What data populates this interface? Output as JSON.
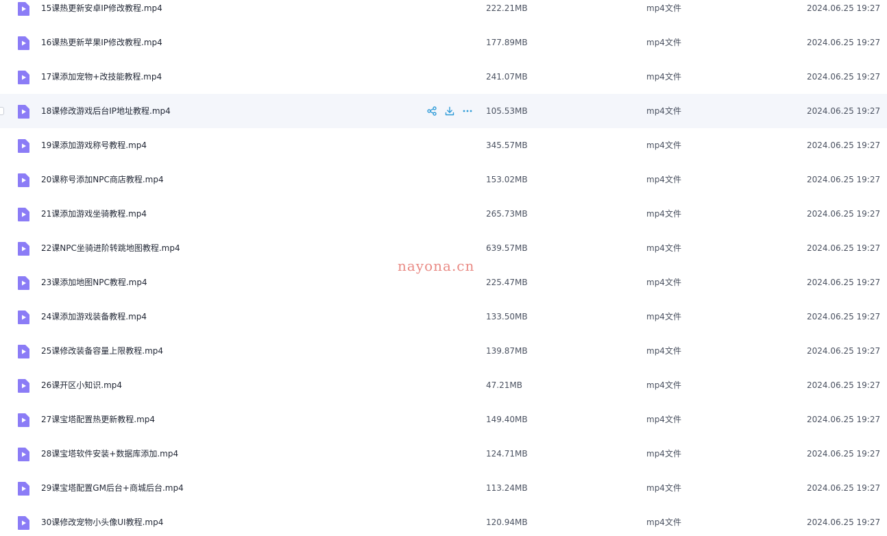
{
  "files": [
    {
      "name": "15课热更新安卓IP修改教程.mp4",
      "size": "222.21MB",
      "type": "mp4文件",
      "date": "2024.06.25 19:27"
    },
    {
      "name": "16课热更新苹果IP修改教程.mp4",
      "size": "177.89MB",
      "type": "mp4文件",
      "date": "2024.06.25 19:27"
    },
    {
      "name": "17课添加宠物+改技能教程.mp4",
      "size": "241.07MB",
      "type": "mp4文件",
      "date": "2024.06.25 19:27"
    },
    {
      "name": "18课修改游戏后台IP地址教程.mp4",
      "size": "105.53MB",
      "type": "mp4文件",
      "date": "2024.06.25 19:27"
    },
    {
      "name": "19课添加游戏称号教程.mp4",
      "size": "345.57MB",
      "type": "mp4文件",
      "date": "2024.06.25 19:27"
    },
    {
      "name": "20课称号添加NPC商店教程.mp4",
      "size": "153.02MB",
      "type": "mp4文件",
      "date": "2024.06.25 19:27"
    },
    {
      "name": "21课添加游戏坐骑教程.mp4",
      "size": "265.73MB",
      "type": "mp4文件",
      "date": "2024.06.25 19:27"
    },
    {
      "name": "22课NPC坐骑进阶转跳地图教程.mp4",
      "size": "639.57MB",
      "type": "mp4文件",
      "date": "2024.06.25 19:27"
    },
    {
      "name": "23课添加地图NPC教程.mp4",
      "size": "225.47MB",
      "type": "mp4文件",
      "date": "2024.06.25 19:27"
    },
    {
      "name": "24课添加游戏装备教程.mp4",
      "size": "133.50MB",
      "type": "mp4文件",
      "date": "2024.06.25 19:27"
    },
    {
      "name": "25课修改装备容量上限教程.mp4",
      "size": "139.87MB",
      "type": "mp4文件",
      "date": "2024.06.25 19:27"
    },
    {
      "name": "26课开区小知识.mp4",
      "size": "47.21MB",
      "type": "mp4文件",
      "date": "2024.06.25 19:27"
    },
    {
      "name": "27课宝塔配置热更新教程.mp4",
      "size": "149.40MB",
      "type": "mp4文件",
      "date": "2024.06.25 19:27"
    },
    {
      "name": "28课宝塔软件安装+数据库添加.mp4",
      "size": "124.71MB",
      "type": "mp4文件",
      "date": "2024.06.25 19:27"
    },
    {
      "name": "29课宝塔配置GM后台+商城后台.mp4",
      "size": "113.24MB",
      "type": "mp4文件",
      "date": "2024.06.25 19:27"
    },
    {
      "name": "30课修改宠物小头像UI教程.mp4",
      "size": "120.94MB",
      "type": "mp4文件",
      "date": "2024.06.25 19:27"
    }
  ],
  "hovered_index": 3,
  "row_actions": [
    "share-icon",
    "download-icon",
    "more-icon"
  ],
  "file_icon": "video-file-icon",
  "watermark": "nayona.cn",
  "colors": {
    "file_icon": "#8b7cf6",
    "action_icon": "#2f9bd8",
    "hover_row": "#f4f6fb",
    "watermark": "#e98a84"
  }
}
